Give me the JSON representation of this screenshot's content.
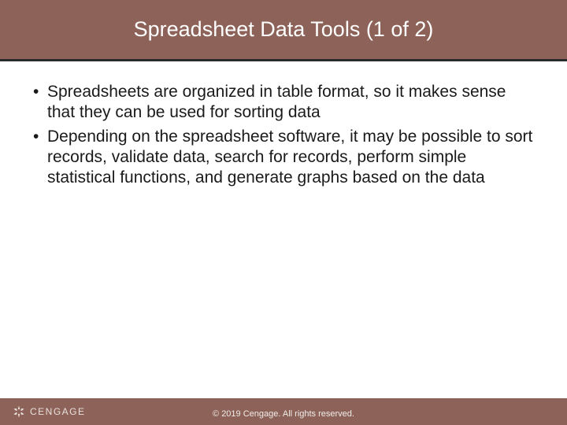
{
  "title": "Spreadsheet Data Tools (1 of 2)",
  "bullets": [
    "Spreadsheets are organized in table format, so it makes sense that they can be used for sorting data",
    "Depending on the spreadsheet software, it may be possible to sort records, validate data, search for records, perform simple statistical functions, and generate graphs based on the data"
  ],
  "footer": {
    "brand": "CENGAGE",
    "copyright": "© 2019 Cengage. All rights reserved."
  }
}
